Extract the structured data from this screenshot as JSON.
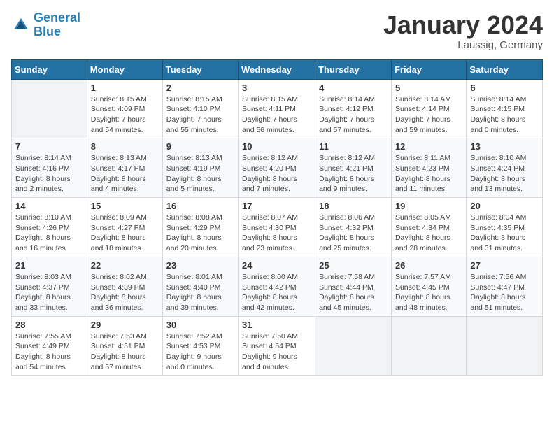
{
  "logo": {
    "line1": "General",
    "line2": "Blue"
  },
  "title": "January 2024",
  "subtitle": "Laussig, Germany",
  "days_of_week": [
    "Sunday",
    "Monday",
    "Tuesday",
    "Wednesday",
    "Thursday",
    "Friday",
    "Saturday"
  ],
  "weeks": [
    [
      {
        "day": "",
        "info": ""
      },
      {
        "day": "1",
        "info": "Sunrise: 8:15 AM\nSunset: 4:09 PM\nDaylight: 7 hours\nand 54 minutes."
      },
      {
        "day": "2",
        "info": "Sunrise: 8:15 AM\nSunset: 4:10 PM\nDaylight: 7 hours\nand 55 minutes."
      },
      {
        "day": "3",
        "info": "Sunrise: 8:15 AM\nSunset: 4:11 PM\nDaylight: 7 hours\nand 56 minutes."
      },
      {
        "day": "4",
        "info": "Sunrise: 8:14 AM\nSunset: 4:12 PM\nDaylight: 7 hours\nand 57 minutes."
      },
      {
        "day": "5",
        "info": "Sunrise: 8:14 AM\nSunset: 4:14 PM\nDaylight: 7 hours\nand 59 minutes."
      },
      {
        "day": "6",
        "info": "Sunrise: 8:14 AM\nSunset: 4:15 PM\nDaylight: 8 hours\nand 0 minutes."
      }
    ],
    [
      {
        "day": "7",
        "info": "Sunrise: 8:14 AM\nSunset: 4:16 PM\nDaylight: 8 hours\nand 2 minutes."
      },
      {
        "day": "8",
        "info": "Sunrise: 8:13 AM\nSunset: 4:17 PM\nDaylight: 8 hours\nand 4 minutes."
      },
      {
        "day": "9",
        "info": "Sunrise: 8:13 AM\nSunset: 4:19 PM\nDaylight: 8 hours\nand 5 minutes."
      },
      {
        "day": "10",
        "info": "Sunrise: 8:12 AM\nSunset: 4:20 PM\nDaylight: 8 hours\nand 7 minutes."
      },
      {
        "day": "11",
        "info": "Sunrise: 8:12 AM\nSunset: 4:21 PM\nDaylight: 8 hours\nand 9 minutes."
      },
      {
        "day": "12",
        "info": "Sunrise: 8:11 AM\nSunset: 4:23 PM\nDaylight: 8 hours\nand 11 minutes."
      },
      {
        "day": "13",
        "info": "Sunrise: 8:10 AM\nSunset: 4:24 PM\nDaylight: 8 hours\nand 13 minutes."
      }
    ],
    [
      {
        "day": "14",
        "info": "Sunrise: 8:10 AM\nSunset: 4:26 PM\nDaylight: 8 hours\nand 16 minutes."
      },
      {
        "day": "15",
        "info": "Sunrise: 8:09 AM\nSunset: 4:27 PM\nDaylight: 8 hours\nand 18 minutes."
      },
      {
        "day": "16",
        "info": "Sunrise: 8:08 AM\nSunset: 4:29 PM\nDaylight: 8 hours\nand 20 minutes."
      },
      {
        "day": "17",
        "info": "Sunrise: 8:07 AM\nSunset: 4:30 PM\nDaylight: 8 hours\nand 23 minutes."
      },
      {
        "day": "18",
        "info": "Sunrise: 8:06 AM\nSunset: 4:32 PM\nDaylight: 8 hours\nand 25 minutes."
      },
      {
        "day": "19",
        "info": "Sunrise: 8:05 AM\nSunset: 4:34 PM\nDaylight: 8 hours\nand 28 minutes."
      },
      {
        "day": "20",
        "info": "Sunrise: 8:04 AM\nSunset: 4:35 PM\nDaylight: 8 hours\nand 31 minutes."
      }
    ],
    [
      {
        "day": "21",
        "info": "Sunrise: 8:03 AM\nSunset: 4:37 PM\nDaylight: 8 hours\nand 33 minutes."
      },
      {
        "day": "22",
        "info": "Sunrise: 8:02 AM\nSunset: 4:39 PM\nDaylight: 8 hours\nand 36 minutes."
      },
      {
        "day": "23",
        "info": "Sunrise: 8:01 AM\nSunset: 4:40 PM\nDaylight: 8 hours\nand 39 minutes."
      },
      {
        "day": "24",
        "info": "Sunrise: 8:00 AM\nSunset: 4:42 PM\nDaylight: 8 hours\nand 42 minutes."
      },
      {
        "day": "25",
        "info": "Sunrise: 7:58 AM\nSunset: 4:44 PM\nDaylight: 8 hours\nand 45 minutes."
      },
      {
        "day": "26",
        "info": "Sunrise: 7:57 AM\nSunset: 4:45 PM\nDaylight: 8 hours\nand 48 minutes."
      },
      {
        "day": "27",
        "info": "Sunrise: 7:56 AM\nSunset: 4:47 PM\nDaylight: 8 hours\nand 51 minutes."
      }
    ],
    [
      {
        "day": "28",
        "info": "Sunrise: 7:55 AM\nSunset: 4:49 PM\nDaylight: 8 hours\nand 54 minutes."
      },
      {
        "day": "29",
        "info": "Sunrise: 7:53 AM\nSunset: 4:51 PM\nDaylight: 8 hours\nand 57 minutes."
      },
      {
        "day": "30",
        "info": "Sunrise: 7:52 AM\nSunset: 4:53 PM\nDaylight: 9 hours\nand 0 minutes."
      },
      {
        "day": "31",
        "info": "Sunrise: 7:50 AM\nSunset: 4:54 PM\nDaylight: 9 hours\nand 4 minutes."
      },
      {
        "day": "",
        "info": ""
      },
      {
        "day": "",
        "info": ""
      },
      {
        "day": "",
        "info": ""
      }
    ]
  ]
}
